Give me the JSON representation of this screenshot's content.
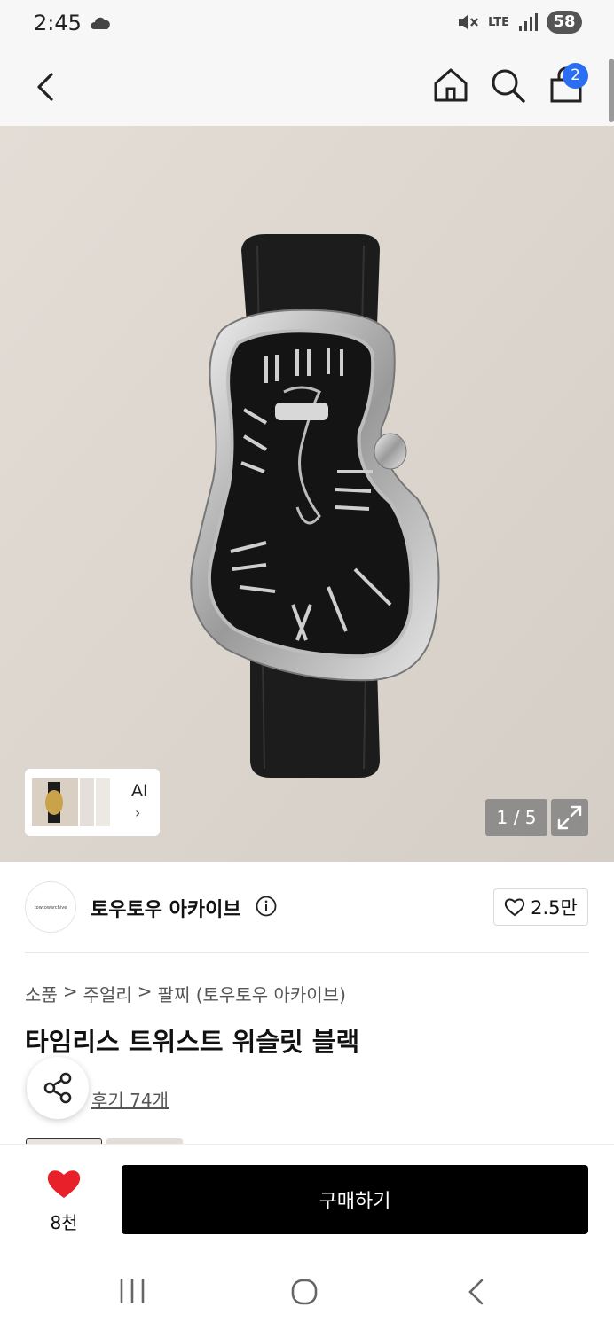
{
  "status": {
    "time": "2:45",
    "battery": "58",
    "network": "LTE"
  },
  "nav": {
    "cart_count": "2"
  },
  "gallery": {
    "counter": "1 / 5",
    "ai_label": "AI",
    "ai_chevron": "›"
  },
  "seller": {
    "name": "토우토우 아카이브",
    "logo_text": "towtowarchive",
    "likes": "2.5만"
  },
  "breadcrumb": [
    "소품",
    "주얼리",
    "팔찌 (토우토우 아카이브)"
  ],
  "breadcrumb_sep": ">",
  "product": {
    "title": "타임리스 트위스트 위슬릿 블랙",
    "reviews": "후기 74개"
  },
  "bottom": {
    "wish_count": "8천",
    "buy_label": "구매하기"
  },
  "colors": {
    "accent": "#2b6ef2",
    "heart": "#e8202a",
    "buy_button": "#000000"
  },
  "icons": [
    "back-icon",
    "home-icon",
    "search-icon",
    "shopping-bag-icon",
    "expand-icon",
    "info-icon",
    "heart-outline-icon",
    "share-icon",
    "heart-filled-icon",
    "recents-icon",
    "home-circle-icon",
    "back-chevron-icon"
  ]
}
